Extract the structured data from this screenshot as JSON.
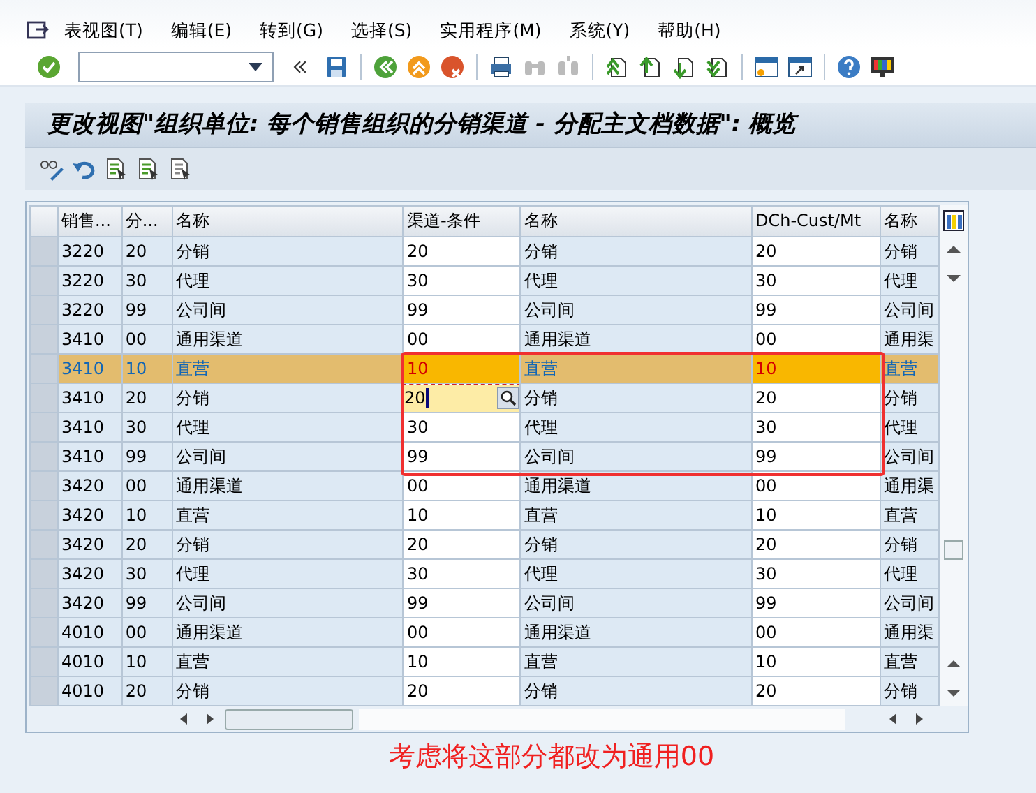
{
  "menu": [
    "表视图(T)",
    "编辑(E)",
    "转到(G)",
    "选择(S)",
    "实用程序(M)",
    "系统(Y)",
    "帮助(H)"
  ],
  "title": "更改视图\"组织单位: 每个销售组织的分销渠道 - 分配主文档数据\": 概览",
  "table": {
    "columns": [
      "销售...",
      "分...",
      "名称",
      "渠道-条件",
      "名称",
      "DCh-Cust/Mt",
      "名称"
    ],
    "rows": [
      {
        "cells": [
          "3220",
          "20",
          "分销",
          "20",
          "分销",
          "20",
          "分销"
        ],
        "selected": false,
        "editing": false,
        "annotated": false
      },
      {
        "cells": [
          "3220",
          "30",
          "代理",
          "30",
          "代理",
          "30",
          "代理"
        ],
        "selected": false,
        "editing": false,
        "annotated": false
      },
      {
        "cells": [
          "3220",
          "99",
          "公司间",
          "99",
          "公司间",
          "99",
          "公司间"
        ],
        "selected": false,
        "editing": false,
        "annotated": false
      },
      {
        "cells": [
          "3410",
          "00",
          "通用渠道",
          "00",
          "通用渠道",
          "00",
          "通用渠"
        ],
        "selected": false,
        "editing": false,
        "annotated": false
      },
      {
        "cells": [
          "3410",
          "10",
          "直营",
          "10",
          "直营",
          "10",
          "直营"
        ],
        "selected": true,
        "editing": false,
        "annotated": true
      },
      {
        "cells": [
          "3410",
          "20",
          "分销",
          "20",
          "分销",
          "20",
          "分销"
        ],
        "selected": false,
        "editing": true,
        "annotated": true
      },
      {
        "cells": [
          "3410",
          "30",
          "代理",
          "30",
          "代理",
          "30",
          "代理"
        ],
        "selected": false,
        "editing": false,
        "annotated": true
      },
      {
        "cells": [
          "3410",
          "99",
          "公司间",
          "99",
          "公司间",
          "99",
          "公司间"
        ],
        "selected": false,
        "editing": false,
        "annotated": true
      },
      {
        "cells": [
          "3420",
          "00",
          "通用渠道",
          "00",
          "通用渠道",
          "00",
          "通用渠"
        ],
        "selected": false,
        "editing": false,
        "annotated": false
      },
      {
        "cells": [
          "3420",
          "10",
          "直营",
          "10",
          "直营",
          "10",
          "直营"
        ],
        "selected": false,
        "editing": false,
        "annotated": false
      },
      {
        "cells": [
          "3420",
          "20",
          "分销",
          "20",
          "分销",
          "20",
          "分销"
        ],
        "selected": false,
        "editing": false,
        "annotated": false
      },
      {
        "cells": [
          "3420",
          "30",
          "代理",
          "30",
          "代理",
          "30",
          "代理"
        ],
        "selected": false,
        "editing": false,
        "annotated": false
      },
      {
        "cells": [
          "3420",
          "99",
          "公司间",
          "99",
          "公司间",
          "99",
          "公司间"
        ],
        "selected": false,
        "editing": false,
        "annotated": false
      },
      {
        "cells": [
          "4010",
          "00",
          "通用渠道",
          "00",
          "通用渠道",
          "00",
          "通用渠"
        ],
        "selected": false,
        "editing": false,
        "annotated": false
      },
      {
        "cells": [
          "4010",
          "10",
          "直营",
          "10",
          "直营",
          "10",
          "直营"
        ],
        "selected": false,
        "editing": false,
        "annotated": false
      },
      {
        "cells": [
          "4010",
          "20",
          "分销",
          "20",
          "分销",
          "20",
          "分销"
        ],
        "selected": false,
        "editing": false,
        "annotated": false
      }
    ]
  },
  "annotation": "考虑将这部分都改为通用00"
}
